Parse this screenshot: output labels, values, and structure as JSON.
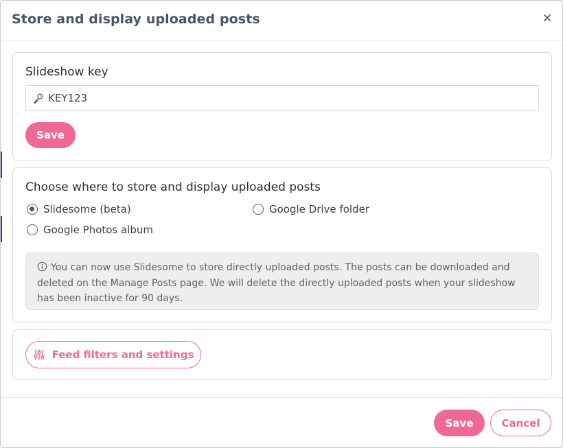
{
  "dialog": {
    "title": "Store and display uploaded posts",
    "close_icon": "close-icon"
  },
  "slideshow_key": {
    "heading": "Slideshow key",
    "input_value": "KEY123",
    "input_icon": "key-icon",
    "save_label": "Save"
  },
  "storage": {
    "heading": "Choose where to store and display uploaded posts",
    "options": [
      {
        "label": "Slidesome (beta)",
        "checked": true
      },
      {
        "label": "Google Drive folder",
        "checked": false
      },
      {
        "label": "Google Photos album",
        "checked": false
      }
    ],
    "info_icon": "info-icon",
    "info_text": "You can now use Slidesome to store directly uploaded posts. The posts can be downloaded and deleted on the Manage Posts page. We will delete the directly uploaded posts when your slideshow has been inactive for 90 days."
  },
  "filters": {
    "button_label": "Feed filters and settings",
    "icon": "sliders-icon"
  },
  "footer": {
    "save_label": "Save",
    "cancel_label": "Cancel"
  },
  "colors": {
    "accent": "#ee6a93",
    "title": "#4a5663",
    "info_bg": "#eeeeee"
  }
}
